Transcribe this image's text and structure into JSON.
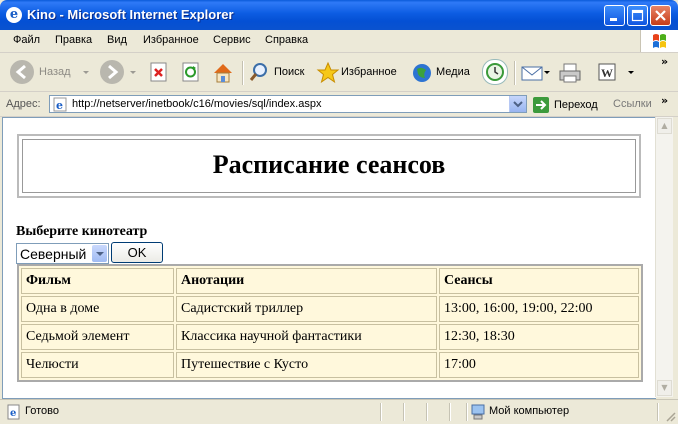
{
  "window": {
    "title": "Kino - Microsoft Internet Explorer"
  },
  "menu": {
    "items": [
      "Файл",
      "Правка",
      "Вид",
      "Избранное",
      "Сервис",
      "Справка"
    ]
  },
  "toolbar": {
    "back_label": "Назад",
    "search_label": "Поиск",
    "favorites_label": "Избранное",
    "media_label": "Медиа"
  },
  "address": {
    "label": "Адрес:",
    "url": "http://netserver/inetbook/c16/movies/sql/index.aspx",
    "go_label": "Переход",
    "links_label": "Ссылки"
  },
  "page": {
    "title": "Расписание сеансов",
    "choose_label": "Выберите кинотеатр",
    "cinema_selected": "Северный",
    "ok_label": "OK",
    "table": {
      "headers": [
        "Фильм",
        "Анотации",
        "Сеансы"
      ],
      "rows": [
        [
          "Одна в доме",
          "Садистский триллер",
          "13:00, 16:00, 19:00, 22:00"
        ],
        [
          "Седьмой элемент",
          "Классика научной фантастики",
          "12:30, 18:30"
        ],
        [
          "Челюсти",
          "Путешествие с Кусто",
          "17:00"
        ]
      ]
    }
  },
  "status": {
    "text": "Готово",
    "zone": "Мой компьютер"
  },
  "colors": {
    "titlebar": "#0a5ad9",
    "grid_background": "#fff8dc"
  }
}
